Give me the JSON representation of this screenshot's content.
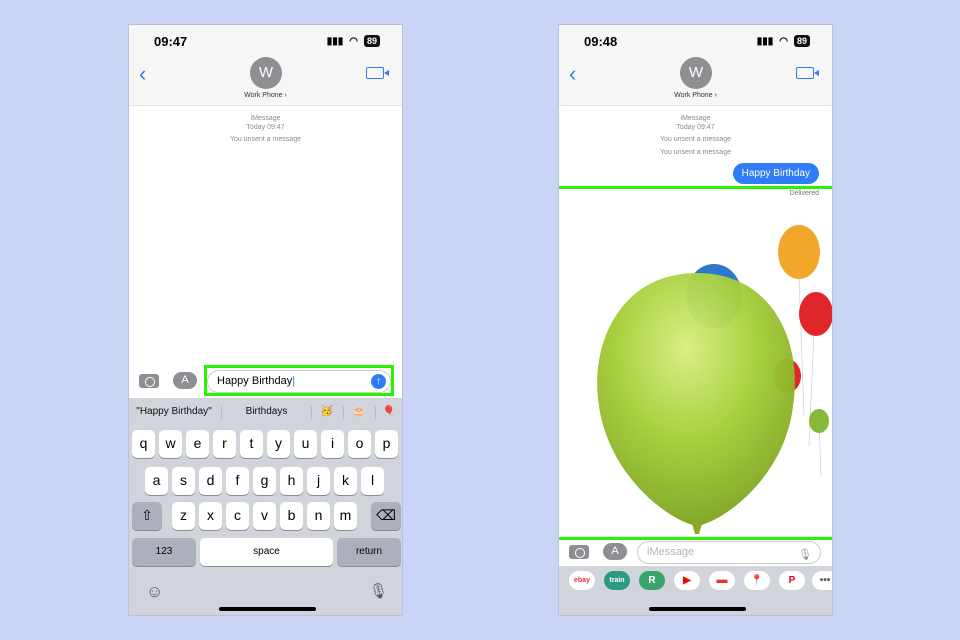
{
  "left": {
    "status": {
      "time": "09:47",
      "battery": "89"
    },
    "contact": {
      "initial": "W",
      "name": "Work Phone ›"
    },
    "meta": {
      "service": "iMessage",
      "timestamp": "Today 09:47",
      "unsent": "You unsent a message"
    },
    "input": {
      "value": "Happy Birthday"
    },
    "suggestions": [
      "\"Happy Birthday\"",
      "Birthdays",
      "🥳",
      "🎂",
      "🎈"
    ],
    "keyboard": {
      "row1": [
        "q",
        "w",
        "e",
        "r",
        "t",
        "y",
        "u",
        "i",
        "o",
        "p"
      ],
      "row2": [
        "a",
        "s",
        "d",
        "f",
        "g",
        "h",
        "j",
        "k",
        "l"
      ],
      "row3": [
        "z",
        "x",
        "c",
        "v",
        "b",
        "n",
        "m"
      ],
      "numbers": "123",
      "space": "space",
      "return": "return"
    }
  },
  "right": {
    "status": {
      "time": "09:48",
      "battery": "89"
    },
    "contact": {
      "initial": "W",
      "name": "Work Phone ›"
    },
    "meta": {
      "service": "iMessage",
      "timestamp": "Today 09:47",
      "unsent1": "You unsent a message",
      "unsent2": "You unsent a message"
    },
    "bubble": "Happy Birthday",
    "delivered": "Delivered",
    "input": {
      "placeholder": "iMessage"
    },
    "apps": [
      "ebay",
      "train",
      "R",
      "youtube",
      "trainline",
      "maps",
      "pinterest",
      "more"
    ],
    "balloon_colors": [
      "#a6cf3a",
      "#2e78c9",
      "#f2a72a",
      "#e0262a",
      "#86b83a"
    ]
  },
  "highlight_color": "#27f500",
  "background_color": "#c9d4f6"
}
